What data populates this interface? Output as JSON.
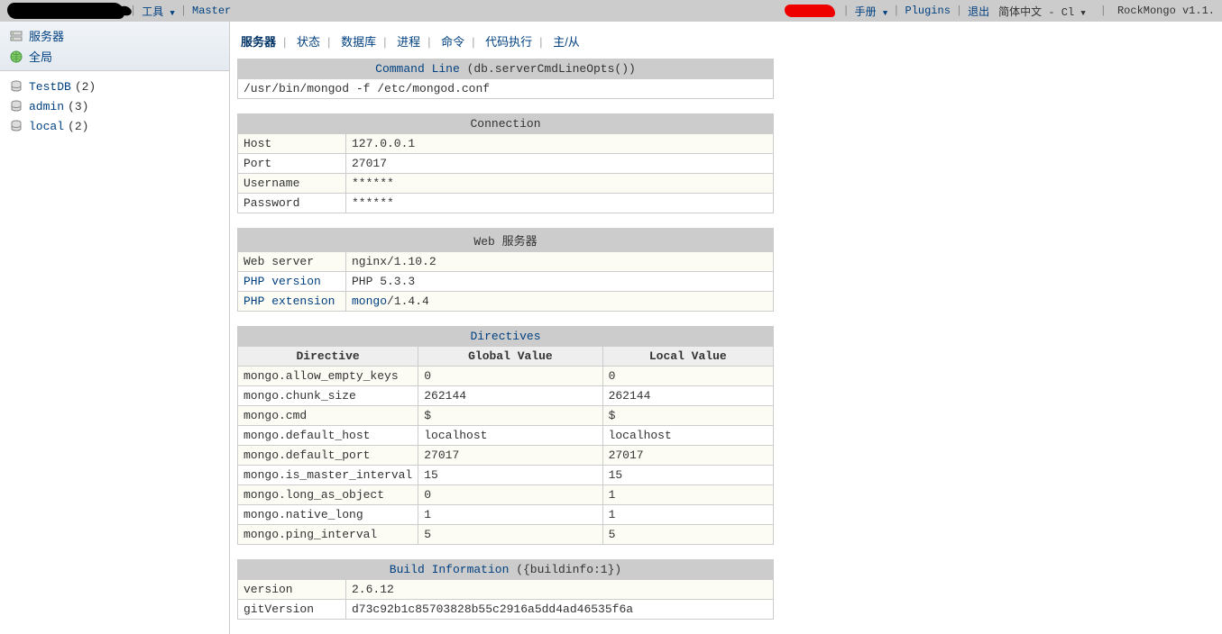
{
  "topbar": {
    "tools": "工具",
    "master": "Master",
    "manual": "手册",
    "plugins": "Plugins",
    "logout": "退出",
    "lang": "简体中文 - Cl",
    "version": "RockMongo v1.1."
  },
  "sidebar": {
    "server": "服务器",
    "global": "全局",
    "dbs": [
      {
        "name": "TestDB",
        "count": "(2)"
      },
      {
        "name": "admin",
        "count": "(3)"
      },
      {
        "name": "local",
        "count": "(2)"
      }
    ]
  },
  "tabs": {
    "server": "服务器",
    "status": "状态",
    "databases": "数据库",
    "processes": "进程",
    "command": "命令",
    "execute": "代码执行",
    "master": "主/从"
  },
  "cmdline": {
    "title": "Command Line",
    "suffix": " (db.serverCmdLineOpts())",
    "value": "/usr/bin/mongod -f /etc/mongod.conf"
  },
  "connection": {
    "title": "Connection",
    "rows": [
      {
        "k": "Host",
        "v": "127.0.0.1"
      },
      {
        "k": "Port",
        "v": "27017"
      },
      {
        "k": "Username",
        "v": "******"
      },
      {
        "k": "Password",
        "v": "******"
      }
    ]
  },
  "webserver": {
    "title": "Web 服务器",
    "rows": [
      {
        "k": "Web server",
        "v": "nginx/1.10.2",
        "klink": false
      },
      {
        "k": "PHP version",
        "v": "PHP 5.3.3",
        "klink": true
      },
      {
        "k": "PHP extension",
        "v": "mongo/1.4.4",
        "klink": true,
        "vlink": "mongo",
        "vrest": "/1.4.4"
      }
    ]
  },
  "directives": {
    "title": "Directives",
    "head": [
      "Directive",
      "Global Value",
      "Local Value"
    ],
    "rows": [
      {
        "d": "mongo.allow_empty_keys",
        "g": "0",
        "l": "0"
      },
      {
        "d": "mongo.chunk_size",
        "g": "262144",
        "l": "262144"
      },
      {
        "d": "mongo.cmd",
        "g": "$",
        "l": "$"
      },
      {
        "d": "mongo.default_host",
        "g": "localhost",
        "l": "localhost"
      },
      {
        "d": "mongo.default_port",
        "g": "27017",
        "l": "27017"
      },
      {
        "d": "mongo.is_master_interval",
        "g": "15",
        "l": "15"
      },
      {
        "d": "mongo.long_as_object",
        "g": "0",
        "l": "1"
      },
      {
        "d": "mongo.native_long",
        "g": "1",
        "l": "1"
      },
      {
        "d": "mongo.ping_interval",
        "g": "5",
        "l": "5"
      }
    ]
  },
  "buildinfo": {
    "title": "Build Information",
    "suffix": " ({buildinfo:1})",
    "rows": [
      {
        "k": "version",
        "v": "2.6.12"
      },
      {
        "k": "gitVersion",
        "v": "d73c92b1c85703828b55c2916a5dd4ad46535f6a"
      }
    ]
  }
}
